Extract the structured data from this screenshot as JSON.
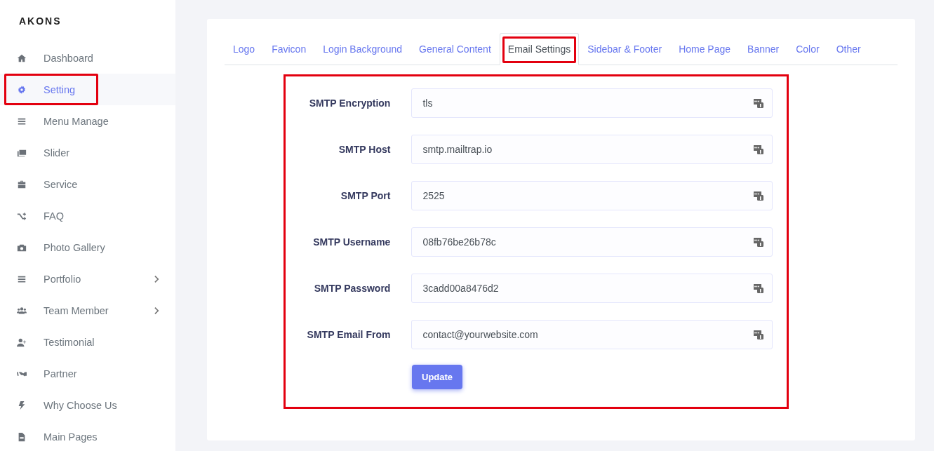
{
  "brand": "AKONS",
  "sidebar": {
    "items": [
      {
        "label": "Dashboard",
        "selected": false,
        "highlighted": false,
        "expandable": false
      },
      {
        "label": "Setting",
        "selected": true,
        "highlighted": true,
        "expandable": false
      },
      {
        "label": "Menu Manage",
        "selected": false,
        "highlighted": false,
        "expandable": false
      },
      {
        "label": "Slider",
        "selected": false,
        "highlighted": false,
        "expandable": false
      },
      {
        "label": "Service",
        "selected": false,
        "highlighted": false,
        "expandable": false
      },
      {
        "label": "FAQ",
        "selected": false,
        "highlighted": false,
        "expandable": false
      },
      {
        "label": "Photo Gallery",
        "selected": false,
        "highlighted": false,
        "expandable": false
      },
      {
        "label": "Portfolio",
        "selected": false,
        "highlighted": false,
        "expandable": true
      },
      {
        "label": "Team Member",
        "selected": false,
        "highlighted": false,
        "expandable": true
      },
      {
        "label": "Testimonial",
        "selected": false,
        "highlighted": false,
        "expandable": false
      },
      {
        "label": "Partner",
        "selected": false,
        "highlighted": false,
        "expandable": false
      },
      {
        "label": "Why Choose Us",
        "selected": false,
        "highlighted": false,
        "expandable": false
      },
      {
        "label": "Main Pages",
        "selected": false,
        "highlighted": false,
        "expandable": false
      }
    ]
  },
  "tabs": [
    {
      "label": "Logo",
      "selected": false,
      "highlighted": false
    },
    {
      "label": "Favicon",
      "selected": false,
      "highlighted": false
    },
    {
      "label": "Login Background",
      "selected": false,
      "highlighted": false
    },
    {
      "label": "General Content",
      "selected": false,
      "highlighted": false
    },
    {
      "label": "Email Settings",
      "selected": true,
      "highlighted": true
    },
    {
      "label": "Sidebar & Footer",
      "selected": false,
      "highlighted": false
    },
    {
      "label": "Home Page",
      "selected": false,
      "highlighted": false
    },
    {
      "label": "Banner",
      "selected": false,
      "highlighted": false
    },
    {
      "label": "Color",
      "selected": false,
      "highlighted": false
    },
    {
      "label": "Other",
      "selected": false,
      "highlighted": false
    }
  ],
  "form": {
    "highlighted": true,
    "fields": [
      {
        "label": "SMTP Encryption",
        "value": "tls"
      },
      {
        "label": "SMTP Host",
        "value": "smtp.mailtrap.io"
      },
      {
        "label": "SMTP Port",
        "value": "2525"
      },
      {
        "label": "SMTP Username",
        "value": "08fb76be26b78c"
      },
      {
        "label": "SMTP Password",
        "value": "3cadd00a8476d2"
      },
      {
        "label": "SMTP Email From",
        "value": "contact@yourwebsite.com"
      }
    ],
    "submit": "Update"
  }
}
